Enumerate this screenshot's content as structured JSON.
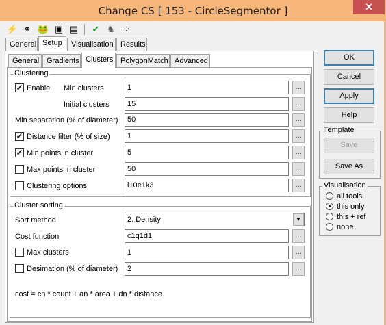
{
  "window": {
    "title": "Change CS [ 153 - CircleSegmentor ]",
    "close_glyph": "✕"
  },
  "toolbar": {
    "icons": [
      {
        "name": "lightning-icon",
        "glyph": "⚡",
        "color": "#000000"
      },
      {
        "name": "link-icon",
        "glyph": "⚭",
        "color": "#000000"
      },
      {
        "name": "frog-icon",
        "glyph": "🐸",
        "color": "#2e7d32"
      },
      {
        "name": "console-icon",
        "glyph": "▣",
        "color": "#333333"
      },
      {
        "name": "notes-icon",
        "glyph": "▤",
        "color": "#333333"
      },
      {
        "name": "checkmark-icon",
        "glyph": "✔",
        "color": "#1a9c2a"
      },
      {
        "name": "figure-icon",
        "glyph": "♞",
        "color": "#555555"
      },
      {
        "name": "dots-icon",
        "glyph": "⁘",
        "color": "#333333"
      }
    ]
  },
  "top_tabs": [
    "General",
    "Setup",
    "Visualisation",
    "Results"
  ],
  "sub_tabs": [
    "General",
    "Gradients",
    "Clusters",
    "PolygonMatch",
    "Advanced"
  ],
  "clustering": {
    "group_label": "Clustering",
    "enable_label": "Enable",
    "enable_checked": true,
    "min_clusters_label": "Min clusters",
    "min_clusters_value": "1",
    "initial_clusters_label": "Initial clusters",
    "initial_clusters_value": "15",
    "min_separation_label": "Min separation (% of diameter)",
    "min_separation_value": "50",
    "distance_filter_label": "Distance filter (% of size)",
    "distance_filter_checked": true,
    "distance_filter_value": "1",
    "min_points_label": "Min points in cluster",
    "min_points_checked": true,
    "min_points_value": "5",
    "max_points_label": "Max points in cluster",
    "max_points_checked": false,
    "max_points_value": "50",
    "options_label": "Clustering options",
    "options_checked": false,
    "options_value": "i10e1k3"
  },
  "sorting": {
    "group_label": "Cluster sorting",
    "sort_method_label": "Sort method",
    "sort_method_value": "2. Density",
    "cost_function_label": "Cost function",
    "cost_function_value": "c1q1d1",
    "max_clusters_label": "Max clusters",
    "max_clusters_checked": false,
    "max_clusters_value": "1",
    "desimation_label": "Desimation (% of diameter)",
    "desimation_checked": false,
    "desimation_value": "2",
    "formula": "cost = cn * count + an * area + dn * distance"
  },
  "ellipsis": "...",
  "check_glyph": "✓",
  "dropdown_glyph": "▼",
  "buttons": {
    "ok": "OK",
    "cancel": "Cancel",
    "apply": "Apply",
    "help": "Help"
  },
  "template": {
    "label": "Template",
    "save": "Save",
    "save_as": "Save As"
  },
  "visualisation": {
    "label": "Visualisation",
    "options": [
      "all tools",
      "this only",
      "this + ref",
      "none"
    ],
    "selected": "this only"
  }
}
